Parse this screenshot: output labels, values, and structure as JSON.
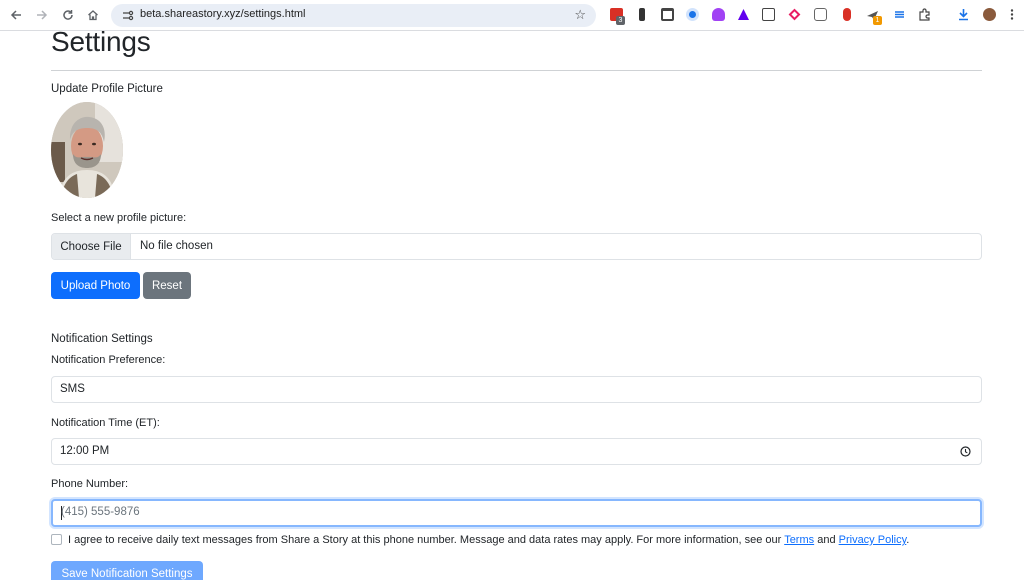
{
  "browser": {
    "url": "beta.shareastory.xyz/settings.html",
    "extension_badges": [
      "3",
      "1"
    ]
  },
  "page": {
    "title": "Settings",
    "profile_picture": {
      "section_label": "Update Profile Picture",
      "avatar_alt": "profile photo",
      "select_label": "Select a new profile picture:",
      "choose_file_label": "Choose File",
      "file_status": "No file chosen",
      "upload_label": "Upload Photo",
      "reset_label": "Reset"
    },
    "notifications": {
      "section_label": "Notification Settings",
      "preference_label": "Notification Preference:",
      "preference_value": "SMS",
      "time_label": "Notification Time (ET):",
      "time_value": "12:00 PM",
      "phone_label": "Phone Number:",
      "phone_placeholder": "(415) 555-9876",
      "consent_text": "I agree to receive daily text messages from Share a Story at this phone number. Message and data rates may apply. For more information, see our",
      "consent_terms": "Terms",
      "consent_and": "and",
      "consent_privacy": "Privacy Policy",
      "consent_end": ".",
      "save_label": "Save Notification Settings"
    }
  },
  "colors": {
    "primary": "#0d6efd",
    "secondary": "#6c757d",
    "disabled": "#6ea8fe",
    "focus_ring": "#86b7fe"
  }
}
